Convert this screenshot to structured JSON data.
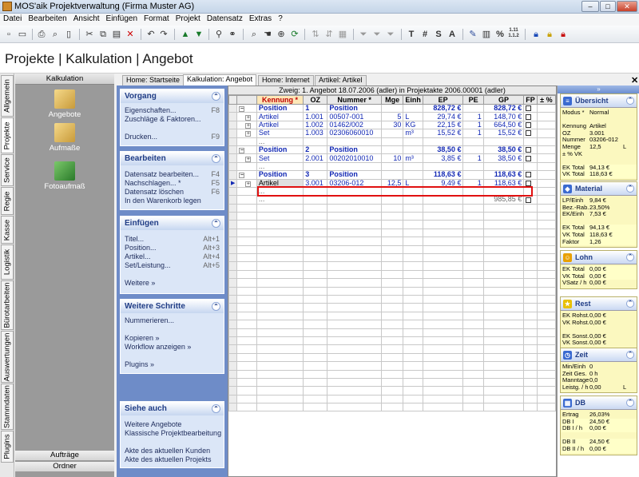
{
  "window": {
    "title": "MOS'aik Projektverwaltung (Firma Muster AG)",
    "min": "–",
    "max": "□",
    "close": "✕"
  },
  "menu": [
    "Datei",
    "Bearbeiten",
    "Ansicht",
    "Einfügen",
    "Format",
    "Projekt",
    "Datensatz",
    "Extras",
    "?"
  ],
  "toolbar": {
    "text_buttons": [
      "T",
      "#",
      "S",
      "A",
      "%",
      "1.11\n1.1.2"
    ]
  },
  "page_title": "Projekte | Kalkulation | Angebot",
  "side_tabs": [
    "Allgemein",
    "Projekte",
    "Service",
    "Regie",
    "Kasse",
    "Logistik",
    "Bürotarbeiten",
    "Auswertungen",
    "Stammdaten",
    "Plugins"
  ],
  "left_panel": {
    "header": "Kalkulation",
    "items": [
      "Angebote",
      "Aufmaße",
      "Fotoaufmaß"
    ],
    "bottom_buttons": [
      "Aufträge",
      "Ordner"
    ]
  },
  "tabs": [
    "Home: Startseite",
    "Kalkulation: Angebot",
    "Home: Internet",
    "Artikel: Artikel"
  ],
  "tasks": [
    {
      "title": "Vorgang",
      "items": [
        [
          "Eigenschaften...",
          "F8"
        ],
        [
          "Zuschläge & Faktoren...",
          ""
        ],
        [
          "",
          ""
        ],
        [
          "Drucken...",
          "F9"
        ]
      ]
    },
    {
      "title": "Bearbeiten",
      "items": [
        [
          "Datensatz bearbeiten...",
          "F4"
        ],
        [
          "Nachschlagen... *",
          "F5"
        ],
        [
          "Datensatz löschen",
          "F6"
        ],
        [
          "In den Warenkorb legen",
          ""
        ]
      ]
    },
    {
      "title": "Einfügen",
      "items": [
        [
          "Titel...",
          "Alt+1"
        ],
        [
          "Position...",
          "Alt+3"
        ],
        [
          "Artikel...",
          "Alt+4"
        ],
        [
          "Set/Leistung...",
          "Alt+5"
        ],
        [
          "",
          ""
        ],
        [
          "Weitere »",
          ""
        ]
      ]
    },
    {
      "title": "Weitere Schritte",
      "items": [
        [
          "Nummerieren...",
          ""
        ],
        [
          "",
          ""
        ],
        [
          "Kopieren »",
          ""
        ],
        [
          "Workflow anzeigen »",
          ""
        ],
        [
          "",
          ""
        ],
        [
          "Plugins »",
          ""
        ]
      ]
    },
    {
      "title": "Siehe auch",
      "items": [
        [
          "Weitere Angebote",
          ""
        ],
        [
          "Klassische Projektbearbeitung",
          ""
        ],
        [
          "",
          ""
        ],
        [
          "Akte des aktuellen Kunden",
          ""
        ],
        [
          "Akte des aktuellen Projekts",
          ""
        ]
      ]
    }
  ],
  "grid": {
    "title": "Zweig: 1. Angebot 18.07.2006 (adler) in Projektakte 2006.00001 (adler)",
    "columns": [
      "Kennung *",
      "OZ",
      "Nummer *",
      "Mge",
      "Einh",
      "EP",
      "PE",
      "GP",
      "FP",
      "± %"
    ],
    "rows": [
      {
        "type": "pos",
        "tree": "−",
        "cells": [
          "Position",
          "1",
          "Position",
          "",
          "",
          "828,72 €",
          "",
          "828,72 €",
          "",
          ""
        ]
      },
      {
        "type": "art",
        "tree": "+",
        "cells": [
          "Artikel",
          "1.001",
          "00507-001",
          "5",
          "L",
          "29,74 €",
          "1",
          "148,70 €",
          "",
          ""
        ]
      },
      {
        "type": "art",
        "tree": "+",
        "cells": [
          "Artikel",
          "1.002",
          "01462/002",
          "30",
          "KG",
          "22,15 €",
          "1",
          "664,50 €",
          "",
          ""
        ]
      },
      {
        "type": "art",
        "tree": "+",
        "cells": [
          "Set",
          "1.003",
          "02306060010",
          "",
          "m³",
          "15,52 €",
          "1",
          "15,52 €",
          "",
          ""
        ]
      },
      {
        "type": "empty",
        "tree": "",
        "cells": [
          "...",
          "",
          "",
          "",
          "",
          "",
          "",
          "",
          "",
          ""
        ]
      },
      {
        "type": "pos",
        "tree": "−",
        "cells": [
          "Position",
          "2",
          "Position",
          "",
          "",
          "38,50 €",
          "",
          "38,50 €",
          "",
          ""
        ]
      },
      {
        "type": "art",
        "tree": "+",
        "cells": [
          "Set",
          "2.001",
          "00202010010",
          "10",
          "m³",
          "3,85 €",
          "1",
          "38,50 €",
          "",
          ""
        ]
      },
      {
        "type": "empty",
        "tree": "",
        "cells": [
          "...",
          "",
          "",
          "",
          "",
          "",
          "",
          "",
          "",
          ""
        ]
      },
      {
        "type": "pos",
        "tree": "−",
        "cells": [
          "Position",
          "3",
          "Position",
          "",
          "",
          "118,63 €",
          "",
          "118,63 €",
          "",
          ""
        ]
      },
      {
        "type": "sel",
        "tree": "+",
        "cells": [
          "Artikel",
          "3.001",
          "03206-012",
          "12,5",
          "L",
          "9,49 €",
          "1",
          "118,63 €",
          "",
          ""
        ]
      },
      {
        "type": "empty",
        "tree": "",
        "cells": [
          "...",
          "",
          "",
          "",
          "",
          "",
          "",
          "",
          "",
          ""
        ]
      },
      {
        "type": "total",
        "tree": "",
        "cells": [
          "...",
          "",
          "",
          "",
          "",
          "",
          "",
          "985,85 €",
          "",
          ""
        ]
      }
    ]
  },
  "right_panel": {
    "header": "»",
    "boxes": [
      {
        "title": "Übersicht",
        "icon": "overview-icon",
        "lines": [
          [
            "Modus *",
            "Normal",
            ""
          ],
          [
            "",
            "",
            ""
          ],
          [
            "Kennung",
            "Artikel",
            ""
          ],
          [
            "OZ",
            "3.001",
            ""
          ],
          [
            "Nummer",
            "03206-012",
            ""
          ],
          [
            "Menge",
            "12,5",
            "L"
          ],
          [
            "± % VK",
            "",
            ""
          ],
          [
            "",
            "",
            ""
          ],
          [
            "EK Total",
            "94,13 €",
            ""
          ],
          [
            "VK Total",
            "118,63 €",
            ""
          ]
        ]
      },
      {
        "title": "Material",
        "icon": "material-icon",
        "lines": [
          [
            "LP/Einh",
            "9,84 €",
            ""
          ],
          [
            "Bez.-Rab.",
            "23,50%",
            ""
          ],
          [
            "EK/Einh",
            "7,53 €",
            ""
          ],
          [
            "",
            "",
            ""
          ],
          [
            "EK Total",
            "94,13 €",
            ""
          ],
          [
            "VK Total",
            "118,63 €",
            ""
          ],
          [
            "Faktor",
            "1,26",
            ""
          ]
        ]
      },
      {
        "title": "Lohn",
        "icon": "lohn-icon",
        "lines": [
          [
            "EK Total",
            "0,00 €",
            ""
          ],
          [
            "VK Total",
            "0,00 €",
            ""
          ],
          [
            "VSatz / h",
            "0,00 €",
            ""
          ]
        ]
      },
      {
        "title": "Rest",
        "icon": "rest-icon",
        "lines": [
          [
            "EK Rohst.",
            "0,00 €",
            ""
          ],
          [
            "VK Rohst.",
            "0,00 €",
            ""
          ],
          [
            "",
            "",
            ""
          ],
          [
            "EK Sonst.",
            "0,00 €",
            ""
          ],
          [
            "VK Sonst.",
            "0,00 €",
            ""
          ]
        ]
      },
      {
        "title": "Zeit",
        "icon": "zeit-icon",
        "lines": [
          [
            "Min/Einh",
            "0",
            ""
          ],
          [
            "Zeit Ges.",
            "0 h",
            ""
          ],
          [
            "Manntage",
            "0,0",
            ""
          ],
          [
            "Leistg. / h",
            "0,00",
            "L"
          ]
        ]
      },
      {
        "title": "DB",
        "icon": "db-icon",
        "lines": [
          [
            "Ertrag",
            "26,03%",
            ""
          ],
          [
            "DB I",
            "24,50 €",
            ""
          ],
          [
            "DB I / h",
            "0,00 €",
            ""
          ],
          [
            "",
            "",
            ""
          ],
          [
            "DB II",
            "24,50 €",
            ""
          ],
          [
            "DB II / h",
            "0,00 €",
            ""
          ]
        ]
      }
    ]
  }
}
